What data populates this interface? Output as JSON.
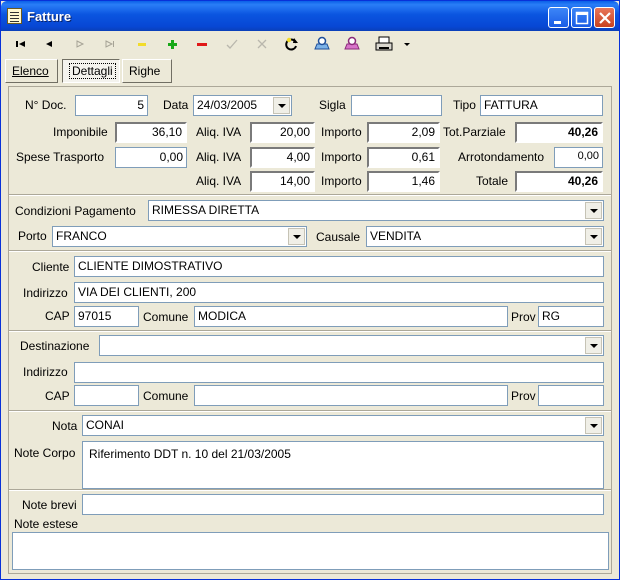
{
  "window": {
    "title": "Fatture"
  },
  "tabs": [
    {
      "label": "Elenco"
    },
    {
      "label": "Dettagli"
    },
    {
      "label": "Righe"
    }
  ],
  "doc": {
    "num_label": "N° Doc.",
    "num_value": "5",
    "data_label": "Data",
    "data_value": "24/03/2005",
    "sigla_label": "Sigla",
    "sigla_value": "",
    "tipo_label": "Tipo",
    "tipo_value": "FATTURA"
  },
  "totals": {
    "imponibile_label": "Imponibile",
    "imponibile_value": "36,10",
    "spese_label": "Spese Trasporto",
    "spese_value": "0,00",
    "aliq_label": "Aliq. IVA",
    "importo_label": "Importo",
    "iva_rows": [
      {
        "aliq": "20,00",
        "importo": "2,09"
      },
      {
        "aliq": "4,00",
        "importo": "0,61"
      },
      {
        "aliq": "14,00",
        "importo": "1,46"
      }
    ],
    "totparziale_label": "Tot.Parziale",
    "totparziale_value": "40,26",
    "arrotondamento_label": "Arrotondamento",
    "arrotondamento_value": "0,00",
    "totale_label": "Totale",
    "totale_value": "40,26"
  },
  "payment": {
    "condizioni_label": "Condizioni Pagamento",
    "condizioni_value": "RIMESSA DIRETTA",
    "porto_label": "Porto",
    "porto_value": "FRANCO",
    "causale_label": "Causale",
    "causale_value": "VENDITA"
  },
  "client": {
    "cliente_label": "Cliente",
    "cliente_value": "CLIENTE DIMOSTRATIVO",
    "indirizzo_label": "Indirizzo",
    "indirizzo_value": "VIA DEI CLIENTI, 200",
    "cap_label": "CAP",
    "cap_value": "97015",
    "comune_label": "Comune",
    "comune_value": "MODICA",
    "prov_label": "Prov",
    "prov_value": "RG"
  },
  "destination": {
    "destinazione_label": "Destinazione",
    "destinazione_value": "",
    "indirizzo_label": "Indirizzo",
    "indirizzo_value": "",
    "cap_label": "CAP",
    "cap_value": "",
    "comune_label": "Comune",
    "comune_value": "",
    "prov_label": "Prov",
    "prov_value": ""
  },
  "notes": {
    "nota_label": "Nota",
    "nota_value": "CONAI",
    "corpo_label": "Note Corpo",
    "corpo_value": "Riferimento DDT n. 10 del 21/03/2005",
    "brevi_label": "Note brevi",
    "brevi_value": "",
    "estese_label": "Note estese",
    "estese_value": ""
  }
}
